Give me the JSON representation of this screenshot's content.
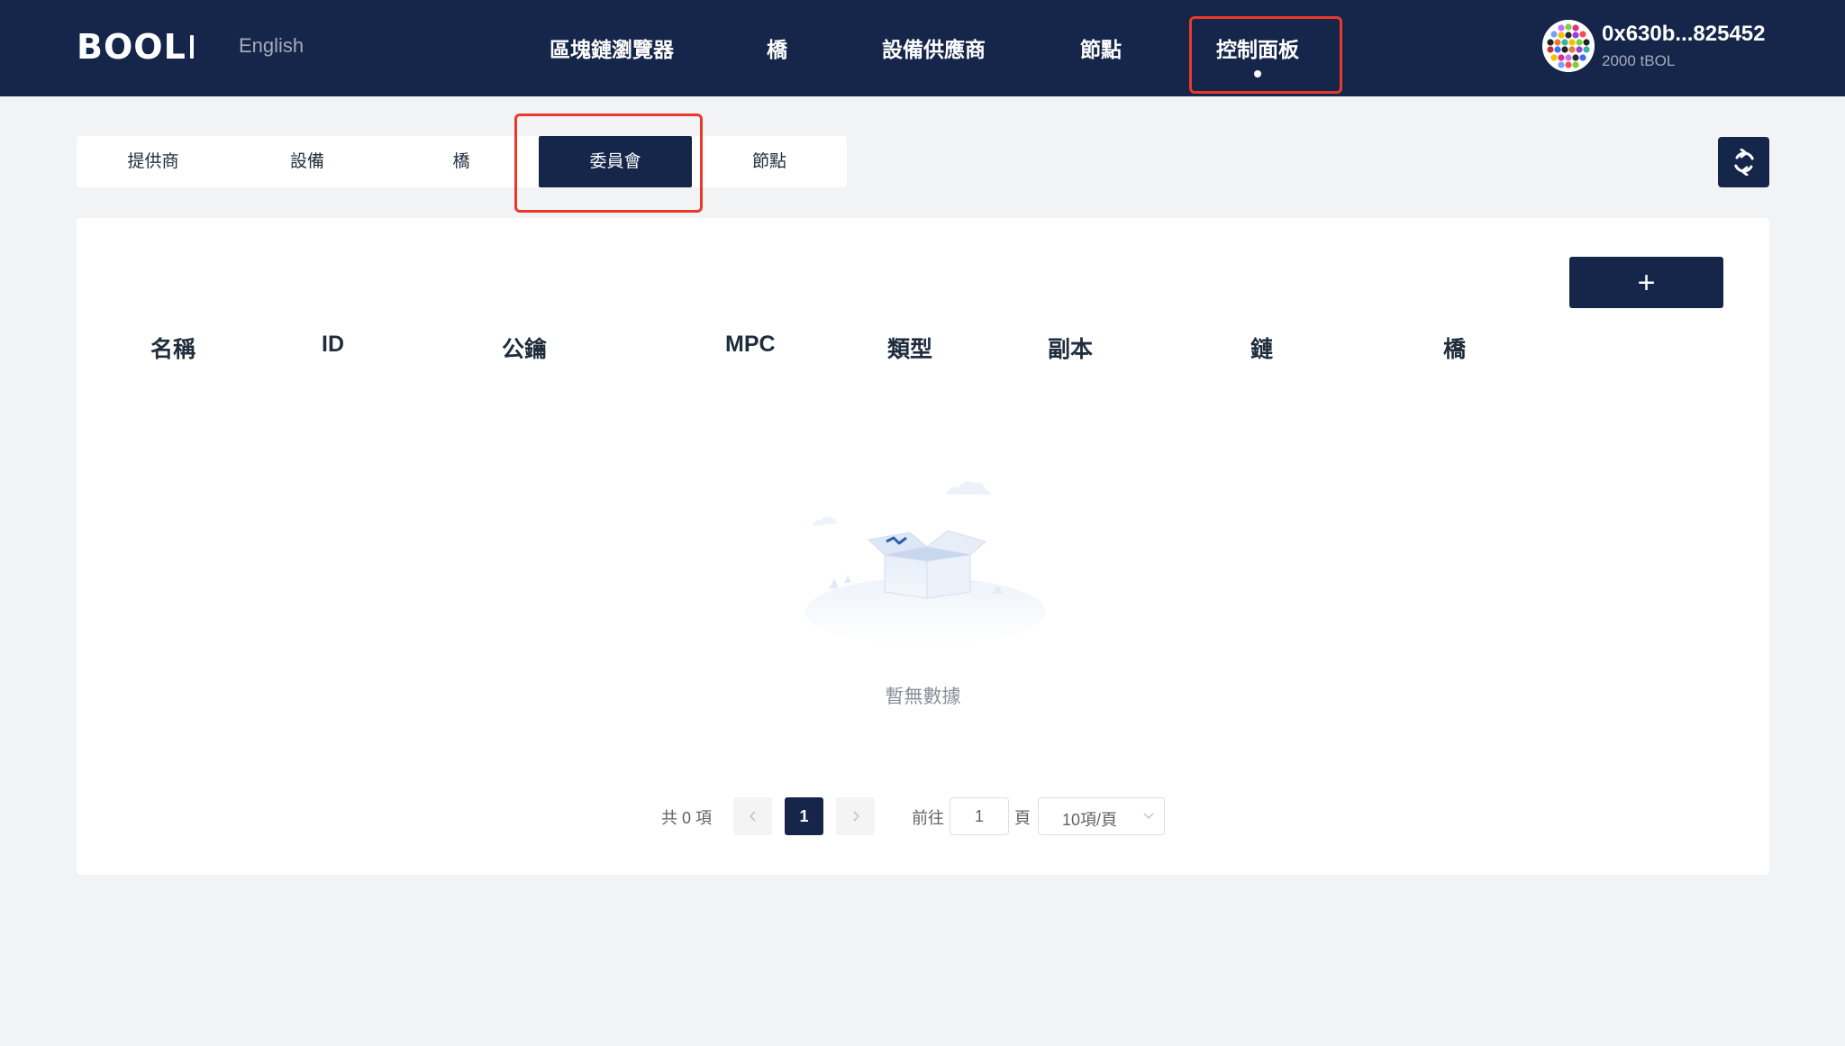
{
  "header": {
    "logo": "BOOL",
    "language": "English",
    "nav": [
      {
        "label": "區塊鏈瀏覽器"
      },
      {
        "label": "橋"
      },
      {
        "label": "設備供應商"
      },
      {
        "label": "節點"
      },
      {
        "label": "控制面板",
        "active": true
      }
    ],
    "account": {
      "address": "0x630b...825452",
      "balance": "2000 tBOL",
      "avatar_icon": "identicon-avatar"
    }
  },
  "sub_tabs": [
    {
      "label": "提供商"
    },
    {
      "label": "設備"
    },
    {
      "label": "橋"
    },
    {
      "label": "委員會",
      "active": true
    },
    {
      "label": "節點"
    }
  ],
  "toolbar": {
    "refresh_icon": "refresh-icon",
    "add_label": "+"
  },
  "table": {
    "columns": [
      "名稱",
      "ID",
      "公鑰",
      "MPC",
      "類型",
      "副本",
      "鏈",
      "橋"
    ],
    "rows": [],
    "empty_text": "暫無數據"
  },
  "pagination": {
    "total_text": "共 0 項",
    "current_page": "1",
    "goto_label": "前往",
    "goto_value": "1",
    "page_suffix": "頁",
    "page_size": "10項/頁"
  },
  "colors": {
    "header_bg": "#15264a",
    "accent": "#15264a",
    "highlight": "#e8392b",
    "page_bg": "#f2f3f5"
  }
}
